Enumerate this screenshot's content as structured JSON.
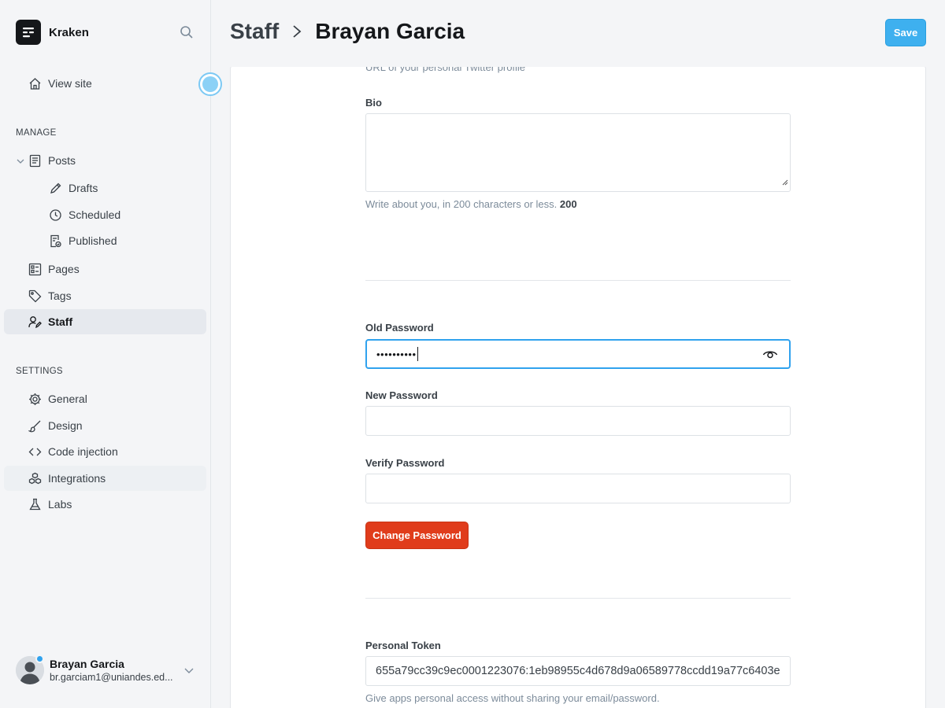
{
  "sidebar": {
    "brand": {
      "name": "Kraken"
    },
    "view_site": "View site",
    "manage_title": "MANAGE",
    "settings_title": "SETTINGS",
    "manage_items": [
      {
        "label": "Posts",
        "icon": "posts-icon"
      },
      {
        "label": "Drafts",
        "icon": "pencil-icon"
      },
      {
        "label": "Scheduled",
        "icon": "clock-icon"
      },
      {
        "label": "Published",
        "icon": "published-icon"
      },
      {
        "label": "Pages",
        "icon": "pages-icon"
      },
      {
        "label": "Tags",
        "icon": "tag-icon"
      },
      {
        "label": "Staff",
        "icon": "staff-icon"
      }
    ],
    "settings_items": [
      {
        "label": "General",
        "icon": "gear-icon"
      },
      {
        "label": "Design",
        "icon": "brush-icon"
      },
      {
        "label": "Code injection",
        "icon": "code-icon"
      },
      {
        "label": "Integrations",
        "icon": "integrations-icon"
      },
      {
        "label": "Labs",
        "icon": "flask-icon"
      }
    ],
    "user": {
      "name": "Brayan Garcia",
      "email": "br.garciam1@uniandes.ed..."
    }
  },
  "header": {
    "crumb": "Staff",
    "title": "Brayan Garcia",
    "save_label": "Save"
  },
  "form": {
    "twitter_hint": "URL of your personal Twitter profile",
    "bio_label": "Bio",
    "bio_value": "",
    "bio_hint": "Write about you, in 200 characters or less.",
    "bio_count": "200",
    "old_password_label": "Old Password",
    "old_password_value": "••••••••••",
    "new_password_label": "New Password",
    "new_password_value": "",
    "verify_password_label": "Verify Password",
    "verify_password_value": "",
    "change_password_label": "Change Password",
    "token_label": "Personal Token",
    "token_value": "655a79cc39c9ec0001223076:1eb98955c4d678d9a06589778ccdd19a77c6403e",
    "token_hint": "Give apps personal access without sharing your email/password."
  },
  "colors": {
    "accent": "#3eb0ef",
    "danger": "#e03c1b",
    "focus": "#30a2ee"
  }
}
